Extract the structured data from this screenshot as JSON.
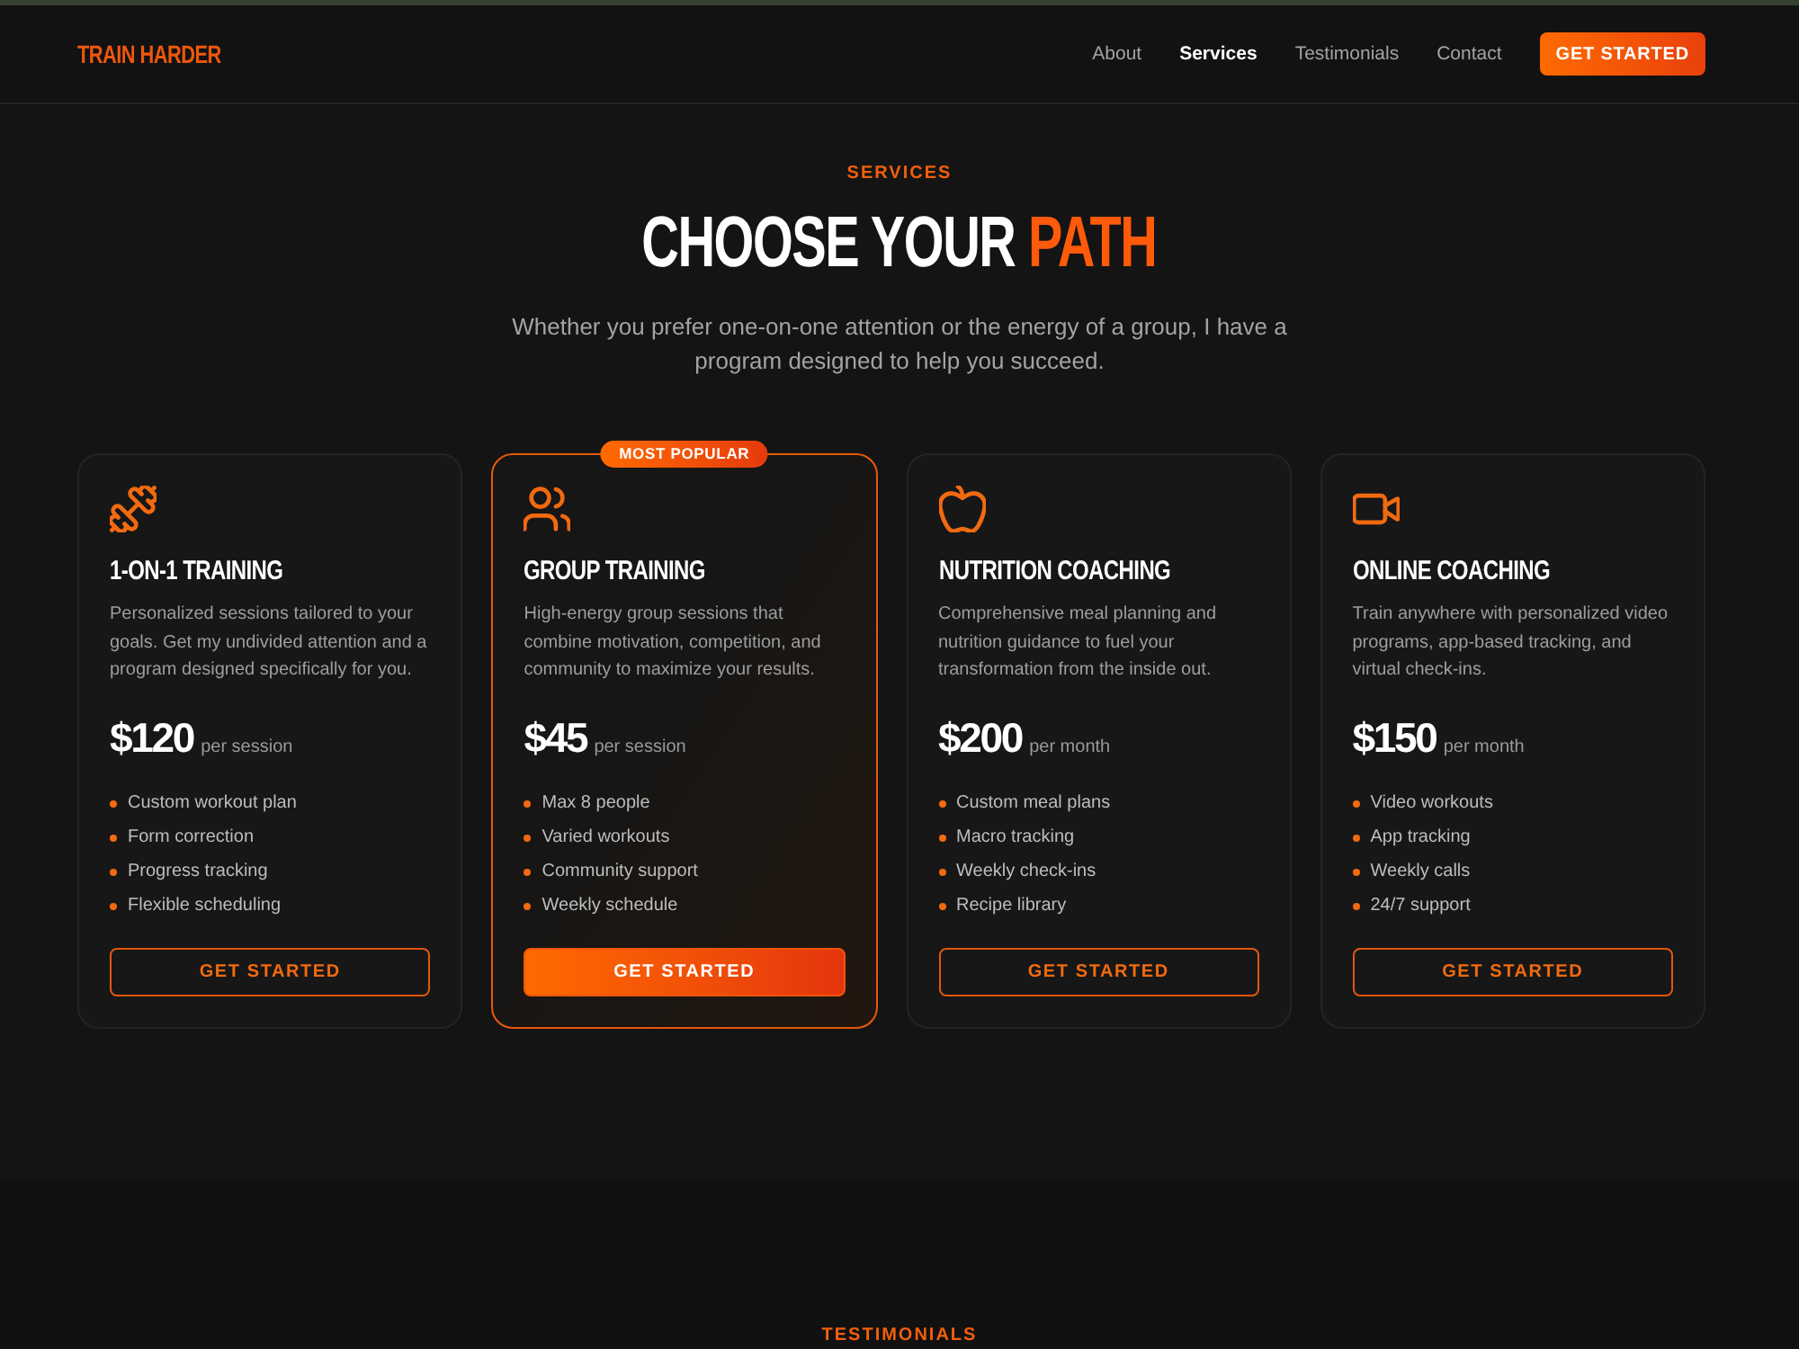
{
  "header": {
    "logo": "TRAIN HARDER",
    "nav": [
      {
        "label": "About",
        "selected": false
      },
      {
        "label": "Services",
        "selected": true
      },
      {
        "label": "Testimonials",
        "selected": false
      },
      {
        "label": "Contact",
        "selected": false
      }
    ],
    "cta": "GET STARTED"
  },
  "services": {
    "eyebrow": "SERVICES",
    "title": "CHOOSE YOUR",
    "title_highlight": "PATH",
    "intro": "Whether you prefer one-on-one attention or the energy of a group, I have a program designed to help you succeed.",
    "cards": [
      {
        "title": "1-ON-1 TRAINING",
        "description": "Personalized sessions tailored to your goals. Get my undivided attention and a program designed specifically for you.",
        "price": "$120",
        "unit": "per session",
        "features": [
          "Custom workout plan",
          "Form correction",
          "Progress tracking",
          "Flexible scheduling"
        ],
        "button": "GET STARTED",
        "featured": false
      },
      {
        "badge": "MOST POPULAR",
        "title": "GROUP TRAINING",
        "description": "High-energy group sessions that combine motivation, competition, and community to maximize your results.",
        "price": "$45",
        "unit": "per session",
        "features": [
          "Max 8 people",
          "Varied workouts",
          "Community support",
          "Weekly schedule"
        ],
        "button": "GET STARTED",
        "featured": true
      },
      {
        "title": "NUTRITION COACHING",
        "description": "Comprehensive meal planning and nutrition guidance to fuel your transformation from the inside out.",
        "price": "$200",
        "unit": "per month",
        "features": [
          "Custom meal plans",
          "Macro tracking",
          "Weekly check-ins",
          "Recipe library"
        ],
        "button": "GET STARTED",
        "featured": false
      },
      {
        "title": "ONLINE COACHING",
        "description": "Train anywhere with personalized video programs, app-based tracking, and virtual check-ins.",
        "price": "$150",
        "unit": "per month",
        "features": [
          "Video workouts",
          "App tracking",
          "Weekly calls",
          "24/7 support"
        ],
        "button": "GET STARTED",
        "featured": false
      }
    ]
  },
  "testimonials": {
    "eyebrow": "TESTIMONIALS"
  }
}
